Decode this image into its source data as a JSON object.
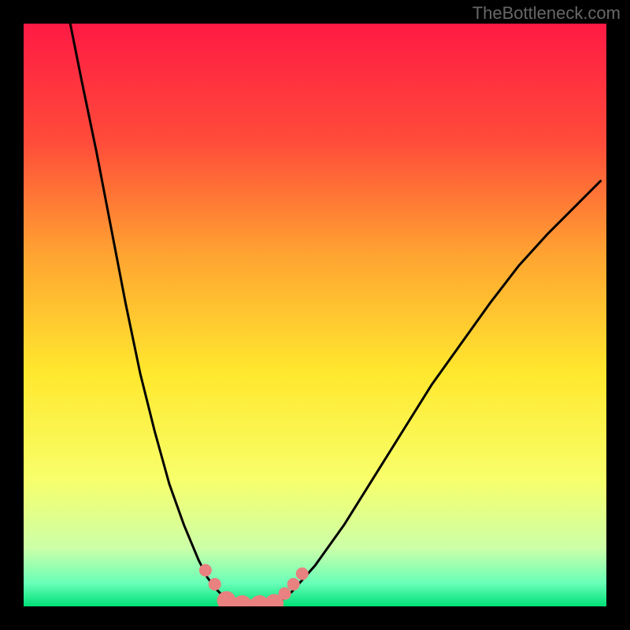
{
  "watermark": "TheBottleneck.com",
  "chart_data": {
    "type": "line",
    "title": "",
    "xlabel": "",
    "ylabel": "",
    "xlim": [
      0,
      100
    ],
    "ylim": [
      0,
      100
    ],
    "gradient": {
      "stops": [
        {
          "pos": 0.0,
          "color": "#ff1a44"
        },
        {
          "pos": 0.2,
          "color": "#ff4b3a"
        },
        {
          "pos": 0.4,
          "color": "#ffa531"
        },
        {
          "pos": 0.6,
          "color": "#ffe82e"
        },
        {
          "pos": 0.78,
          "color": "#f8ff6a"
        },
        {
          "pos": 0.9,
          "color": "#ccffa8"
        },
        {
          "pos": 0.96,
          "color": "#69ffb8"
        },
        {
          "pos": 1.0,
          "color": "#00e077"
        }
      ]
    },
    "series": [
      {
        "name": "left-curve",
        "x": [
          8.0,
          10.0,
          12.5,
          15.0,
          17.5,
          20.0,
          22.5,
          25.0,
          27.5,
          30.0,
          31.5,
          33.0,
          34.5,
          36.0,
          37.5
        ],
        "y": [
          100.0,
          90.0,
          78.0,
          65.0,
          52.0,
          40.0,
          30.0,
          21.0,
          14.0,
          8.0,
          5.0,
          3.0,
          1.5,
          0.5,
          0.0
        ]
      },
      {
        "name": "right-curve",
        "x": [
          43.0,
          46.0,
          50.0,
          55.0,
          60.0,
          65.0,
          70.0,
          75.0,
          80.0,
          85.0,
          90.0,
          95.0,
          99.0
        ],
        "y": [
          0.0,
          2.5,
          7.0,
          14.0,
          22.0,
          30.0,
          38.0,
          45.0,
          52.0,
          58.5,
          64.0,
          69.0,
          73.0
        ]
      },
      {
        "name": "valley-floor",
        "x": [
          37.5,
          40.0,
          43.0
        ],
        "y": [
          0.0,
          0.0,
          0.0
        ]
      }
    ],
    "markers": {
      "name": "highlight-dots",
      "color": "#e8817f",
      "radius_small": 8,
      "radius_large": 12,
      "points": [
        {
          "x": 31.2,
          "y": 6.2,
          "r": "small"
        },
        {
          "x": 32.8,
          "y": 3.8,
          "r": "small"
        },
        {
          "x": 34.8,
          "y": 1.0,
          "r": "large"
        },
        {
          "x": 37.5,
          "y": 0.3,
          "r": "large"
        },
        {
          "x": 40.5,
          "y": 0.3,
          "r": "large"
        },
        {
          "x": 43.0,
          "y": 0.5,
          "r": "large"
        },
        {
          "x": 44.8,
          "y": 2.2,
          "r": "small"
        },
        {
          "x": 46.3,
          "y": 3.8,
          "r": "small"
        },
        {
          "x": 47.8,
          "y": 5.6,
          "r": "small"
        }
      ]
    }
  }
}
